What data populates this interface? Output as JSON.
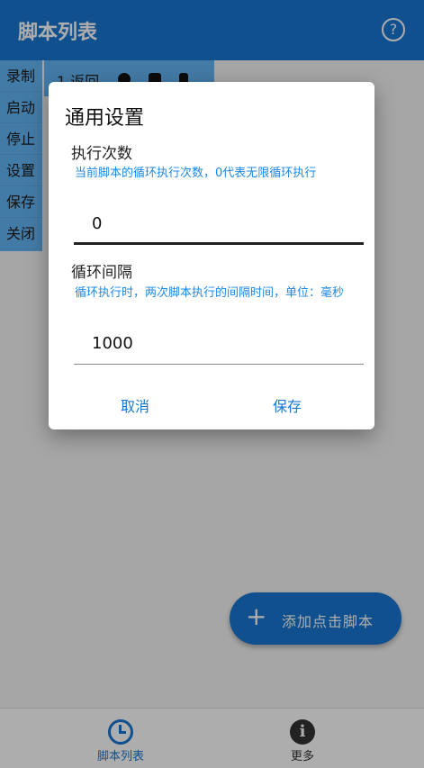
{
  "app": {
    "title": "脚本列表",
    "help_icon": "question-circle-icon"
  },
  "side_menu": {
    "items": [
      "录制",
      "启动",
      "停止",
      "设置",
      "保存",
      "关闭"
    ]
  },
  "script_row": {
    "label": "1 返回"
  },
  "fab": {
    "label": "添加点击脚本",
    "icon": "plus-icon"
  },
  "bottom_nav": {
    "items": [
      {
        "label": "脚本列表",
        "icon": "clock-icon",
        "active": true
      },
      {
        "label": "更多",
        "icon": "info-icon",
        "active": false
      }
    ]
  },
  "dialog": {
    "title": "通用设置",
    "fields": [
      {
        "label": "执行次数",
        "hint": "当前脚本的循环执行次数，0代表无限循环执行",
        "value": "0"
      },
      {
        "label": "循环间隔",
        "hint": "循环执行时，两次脚本执行的间隔时间，单位：毫秒",
        "value": "1000"
      }
    ],
    "cancel_label": "取消",
    "save_label": "保存"
  },
  "colors": {
    "primary": "#1976d2",
    "menu_bg": "#64b5f6",
    "hint": "#1e88e5"
  }
}
